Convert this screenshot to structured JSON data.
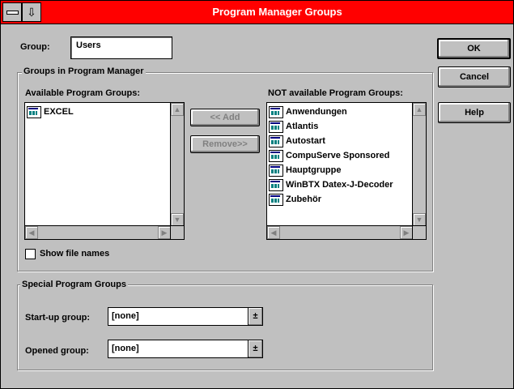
{
  "window": {
    "title": "Program Manager Groups",
    "sysmenu_glyph": "⇩"
  },
  "group_field": {
    "label": "Group:",
    "value": "Users"
  },
  "groups_section": {
    "title": "Groups in Program Manager"
  },
  "available": {
    "label": "Available Program Groups:",
    "items": [
      "EXCEL"
    ]
  },
  "not_available": {
    "label": "NOT available Program Groups:",
    "items": [
      "Anwendungen",
      "Atlantis",
      "Autostart",
      "CompuServe Sponsored",
      "Hauptgruppe",
      "WinBTX Datex-J-Decoder",
      "Zubehör"
    ]
  },
  "buttons": {
    "ok": "OK",
    "cancel": "Cancel",
    "help": "Help",
    "add": "<< Add",
    "remove": "Remove>>"
  },
  "show_file_names": {
    "label": "Show file names",
    "checked": false
  },
  "special_section": {
    "title": "Special Program Groups"
  },
  "startup_group": {
    "label": "Start-up group:",
    "value": "[none]"
  },
  "opened_group": {
    "label": "Opened group:",
    "value": "[none]"
  },
  "colors": {
    "titlebar": "#ff0000",
    "face": "#c0c0c0"
  }
}
